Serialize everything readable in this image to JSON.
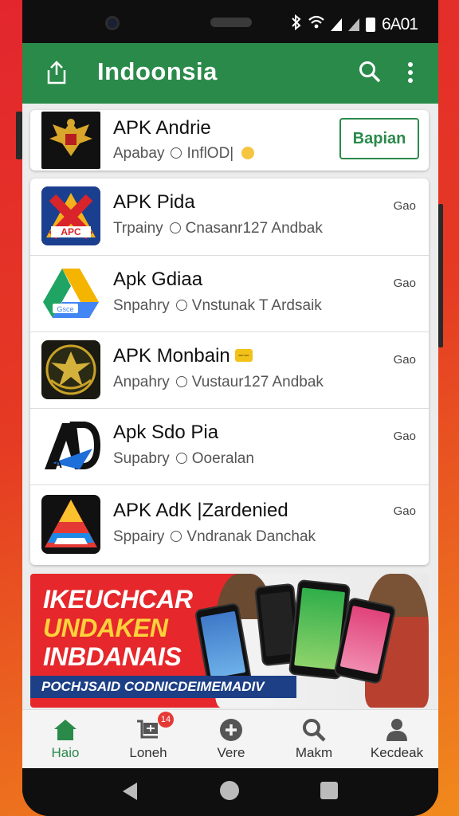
{
  "status_bar": {
    "time": "6A01",
    "icons": [
      "bluetooth-icon",
      "wifi-icon",
      "signal-icon",
      "signal-icon",
      "battery-icon"
    ]
  },
  "app_bar": {
    "title": "Indoonsia",
    "icons": [
      "share-icon",
      "search-icon",
      "more-vert-icon"
    ]
  },
  "featured": {
    "title": "APK Andrie",
    "subtitle_left": "Apabay",
    "subtitle_right": "InflOD|",
    "button_label": "Bapian"
  },
  "apps": [
    {
      "title": "APK Pida",
      "sub_left": "Trpainy",
      "sub_right": "Cnasanr127 Andbak",
      "action": "Gao",
      "icon": "apc-logo-icon"
    },
    {
      "title": "Apk Gdiaa",
      "sub_left": "Snpahry",
      "sub_right": "Vnstunak T Ardsaik",
      "action": "Gao",
      "icon": "drive-logo-icon"
    },
    {
      "title": "APK Monbain",
      "badge": "−−",
      "sub_left": "Anpahry",
      "sub_right": "Vustaur127 Andbak",
      "action": "Gao",
      "icon": "garuda-emblem-icon"
    },
    {
      "title": "Apk Sdo Pia",
      "sub_left": "Supabry",
      "sub_right": "Ooeralan",
      "action": "Gao",
      "icon": "ad-logo-icon"
    },
    {
      "title": "APK AdK |Zardenied",
      "sub_left": "Sppairy",
      "sub_right": "Vndranak Danchak",
      "action": "Gao",
      "icon": "triangle-logo-icon"
    }
  ],
  "banner": {
    "line1": "IKEUCHCAR",
    "line2": "UNDAKEN",
    "line3": "INBDANAIS",
    "strip": "POCHJSAID CODNICDEIMEMADIV"
  },
  "bottom_nav": [
    {
      "label": "Haio",
      "icon": "home-icon",
      "active": true
    },
    {
      "label": "Loneh",
      "icon": "cart-icon",
      "badge": "14"
    },
    {
      "label": "Vere",
      "icon": "plus-circle-icon"
    },
    {
      "label": "Makm",
      "icon": "search-icon"
    },
    {
      "label": "Kecdeak",
      "icon": "person-icon"
    }
  ],
  "colors": {
    "primary": "#2a8a4a",
    "background_red": "#e3262e",
    "banner_red": "#e6272b",
    "banner_yellow": "#ffd23c",
    "banner_blue": "#1d3f86"
  }
}
